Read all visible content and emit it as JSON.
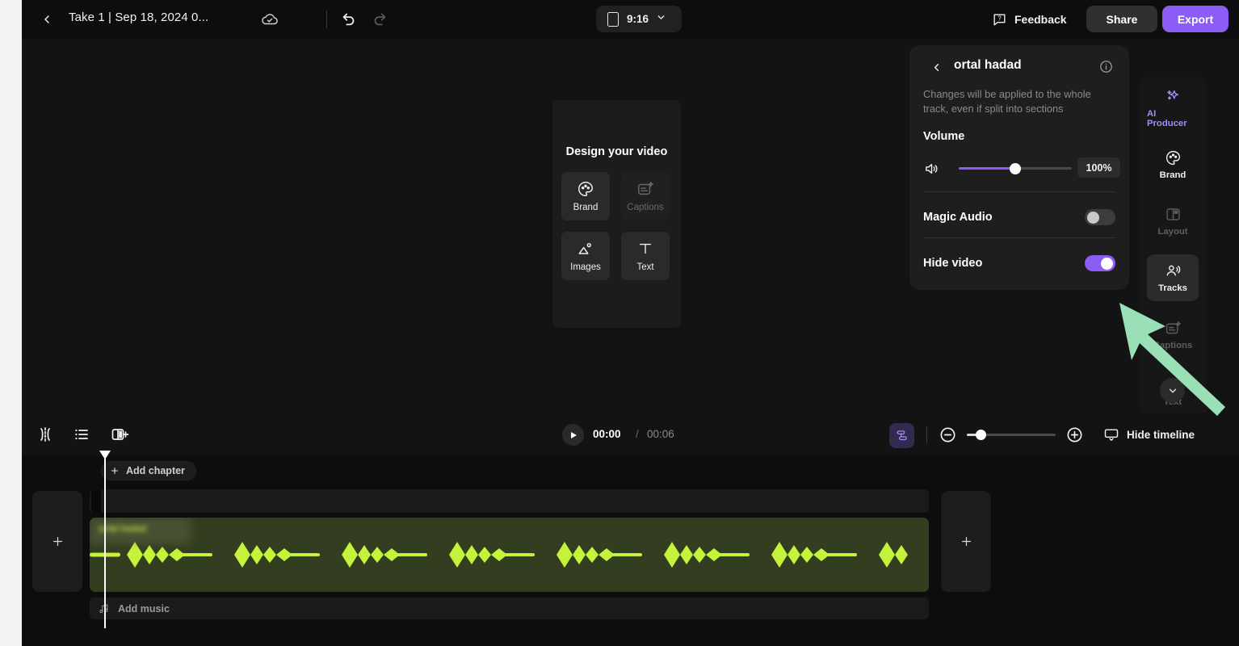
{
  "header": {
    "back_icon": "chevron-left-icon",
    "project_title": "Take 1 | Sep 18, 2024 0...",
    "cloud_icon": "cloud-saved-icon",
    "undo_icon": "undo-icon",
    "redo_icon": "redo-icon",
    "aspect_ratio": "9:16",
    "aspect_icon": "phone-portrait-icon",
    "aspect_chevron": "chevron-down-icon",
    "feedback_label": "Feedback",
    "feedback_icon": "question-bubble-icon",
    "share_label": "Share",
    "export_label": "Export"
  },
  "canvas": {
    "design_title": "Design your video",
    "tiles": [
      {
        "label": "Brand",
        "icon": "palette-icon",
        "enabled": true
      },
      {
        "label": "Captions",
        "icon": "captions-sparkle-icon",
        "enabled": false
      },
      {
        "label": "Images",
        "icon": "image-icon",
        "enabled": true
      },
      {
        "label": "Text",
        "icon": "text-t-icon",
        "enabled": true
      }
    ]
  },
  "panel": {
    "back_icon": "chevron-left-icon",
    "title": "ortal hadad",
    "info_icon": "info-circle-icon",
    "subtitle": "Changes will be applied to the whole track, even if split into sections",
    "volume_label": "Volume",
    "volume_icon": "speaker-volume-icon",
    "volume_value": "100%",
    "volume_percent": 50,
    "rows": [
      {
        "label": "Magic Audio",
        "state": "off"
      },
      {
        "label": "Hide video",
        "state": "on"
      }
    ]
  },
  "sidebar": {
    "items": [
      {
        "label": "AI Producer",
        "icon": "sparkle-wand-icon",
        "state": "accent"
      },
      {
        "label": "Brand",
        "icon": "palette-icon",
        "state": "normal"
      },
      {
        "label": "Layout",
        "icon": "layout-panels-icon",
        "state": "disabled"
      },
      {
        "label": "Tracks",
        "icon": "people-tracks-icon",
        "state": "active"
      },
      {
        "label": "Captions",
        "icon": "captions-sparkle-icon",
        "state": "disabled"
      },
      {
        "label": "Text",
        "icon": "text-t-icon",
        "state": "disabled"
      }
    ],
    "more_icon": "chevron-down-icon"
  },
  "timeline_bar": {
    "split_icon": "split-clip-icon",
    "list_icon": "list-view-icon",
    "add_scene_icon": "add-scene-icon",
    "play_icon": "play-icon",
    "current_time": "00:00",
    "time_separator": "/",
    "total_time": "00:06",
    "magnet_icon": "snap-tracks-icon",
    "zoom_out_icon": "zoom-out-icon",
    "zoom_in_icon": "zoom-in-icon",
    "zoom_percent": 16,
    "hide_timeline_label": "Hide timeline",
    "hide_timeline_icon": "monitor-collapse-icon"
  },
  "timeline": {
    "add_chapter_label": "Add chapter",
    "add_chapter_icon": "plus-icon",
    "add_track_left_icon": "plus-icon",
    "add_track_right_icon": "plus-icon",
    "clip_label": "ortal hadad",
    "clip_chevron": "chevron-down-icon",
    "add_music_label": "Add music",
    "add_music_icon": "music-note-icon",
    "waveform_color": "#c5f23a",
    "clip_background": "#333d1f"
  },
  "annotation": {
    "arrow_icon": "pointer-arrow-icon",
    "arrow_color": "#99e0b6",
    "points_at": "Hide video toggle"
  },
  "colors": {
    "accent_purple": "#8b5cf6",
    "app_background": "#0d0d0d",
    "panel_background": "#1e1e1e",
    "waveform_green": "#c5f23a"
  }
}
